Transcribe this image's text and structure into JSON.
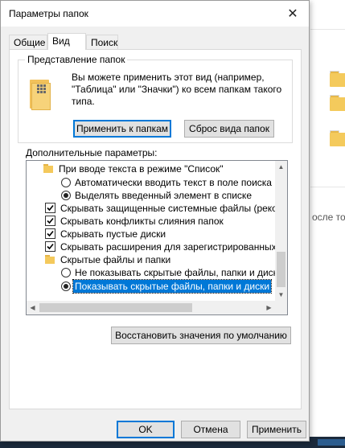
{
  "background": {
    "partial_text": "осле то"
  },
  "dialog": {
    "title": "Параметры папок",
    "close_glyph": "✕"
  },
  "tabs": [
    {
      "label": "Общие",
      "active": false
    },
    {
      "label": "Вид",
      "active": true
    },
    {
      "label": "Поиск",
      "active": false
    }
  ],
  "folder_view": {
    "group_title": "Представление папок",
    "description": "Вы можете применить этот вид (например, \"Таблица\" или \"Значки\") ко всем папкам такого типа.",
    "apply_button": "Применить к папкам",
    "reset_button": "Сброс вида папок"
  },
  "advanced": {
    "label": "Дополнительные параметры:",
    "items": [
      {
        "kind": "folder",
        "text": "При вводе текста в режиме \"Список\""
      },
      {
        "kind": "radio",
        "checked": false,
        "text": "Автоматически вводить текст в поле поиска"
      },
      {
        "kind": "radio",
        "checked": true,
        "text": "Выделять введенный элемент в списке"
      },
      {
        "kind": "check",
        "checked": true,
        "text": "Скрывать защищенные системные файлы (рекомен"
      },
      {
        "kind": "check",
        "checked": true,
        "text": "Скрывать конфликты слияния папок"
      },
      {
        "kind": "check",
        "checked": true,
        "text": "Скрывать пустые диски"
      },
      {
        "kind": "check",
        "checked": true,
        "text": "Скрывать расширения для зарегистрированных типо"
      },
      {
        "kind": "folder",
        "text": "Скрытые файлы и папки"
      },
      {
        "kind": "radio",
        "checked": false,
        "text": "Не показывать скрытые файлы, папки и диски"
      },
      {
        "kind": "radio",
        "checked": true,
        "selected": true,
        "text": "Показывать скрытые файлы, папки и диски"
      }
    ],
    "restore_button": "Восстановить значения по умолчанию"
  },
  "footer": {
    "ok": "OK",
    "cancel": "Отмена",
    "apply": "Применить"
  },
  "colors": {
    "selection": "#0078d7",
    "dialog_bg": "#f0f0f0",
    "folder": "#f4c95c"
  }
}
